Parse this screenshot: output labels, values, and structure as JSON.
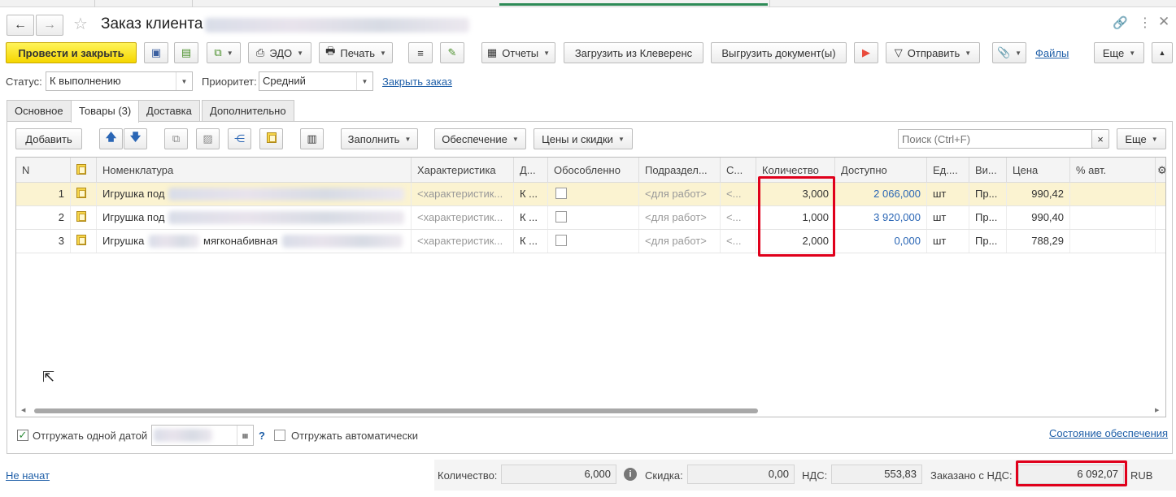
{
  "window": {
    "title": "Заказ клиента"
  },
  "toolbar": {
    "post_close": "Провести и закрыть",
    "edo": "ЭДО",
    "print": "Печать",
    "reports": "Отчеты",
    "load_kleverens": "Загрузить из Клеверенс",
    "export_docs": "Выгрузить документ(ы)",
    "send": "Отправить",
    "files": "Файлы",
    "more": "Еще"
  },
  "status_row": {
    "status_label": "Статус:",
    "status_value": "К выполнению",
    "priority_label": "Приоритет:",
    "priority_value": "Средний",
    "close_order": "Закрыть заказ"
  },
  "tabs": [
    "Основное",
    "Товары (3)",
    "Доставка",
    "Дополнительно"
  ],
  "table_toolbar": {
    "add": "Добавить",
    "fill": "Заполнить",
    "supply": "Обеспечение",
    "prices": "Цены и скидки",
    "search_placeholder": "Поиск (Ctrl+F)",
    "clear": "×",
    "more": "Еще"
  },
  "table": {
    "columns": [
      "N",
      "",
      "Номенклатура",
      "Характеристика",
      "Д...",
      "Обособленно",
      "Подраздел...",
      "С...",
      "Количество",
      "Доступно",
      "Ед....",
      "Ви...",
      "Цена",
      "% авт."
    ],
    "rows": [
      {
        "n": "1",
        "name": "Игрушка под",
        "char": "<характеристик...",
        "d": "К ...",
        "sub": "<для работ>",
        "s": "<...",
        "qty": "3,000",
        "avail": "2 066,000",
        "unit": "шт",
        "kind": "Пр...",
        "price": "990,42"
      },
      {
        "n": "2",
        "name": "Игрушка под",
        "char": "<характеристик...",
        "d": "К ...",
        "sub": "<для работ>",
        "s": "<...",
        "qty": "1,000",
        "avail": "3 920,000",
        "unit": "шт",
        "kind": "Пр...",
        "price": "990,40"
      },
      {
        "n": "3",
        "name": "Игрушка",
        "name2": "мягконабивная",
        "char": "<характеристик...",
        "d": "К ...",
        "sub": "<для работ>",
        "s": "<...",
        "qty": "2,000",
        "avail": "0,000",
        "unit": "шт",
        "kind": "Пр...",
        "price": "788,29"
      }
    ]
  },
  "bottom": {
    "ship_one_date": "Отгружать одной датой",
    "help": "?",
    "ship_auto": "Отгружать автоматически",
    "supply_state": "Состояние обеспечения"
  },
  "footer": {
    "not_started": "Не начат",
    "qty_label": "Количество:",
    "qty_value": "6,000",
    "discount_label": "Скидка:",
    "discount_value": "0,00",
    "vat_label": "НДС:",
    "vat_value": "553,83",
    "ordered_label": "Заказано с НДС:",
    "ordered_value": "6 092,07",
    "currency": "RUB"
  },
  "colors": {
    "accent_yellow": "#f5d600",
    "link_blue": "#1f5fa8",
    "highlight_red": "#e0001b",
    "selected_row": "#fbf3d1"
  }
}
